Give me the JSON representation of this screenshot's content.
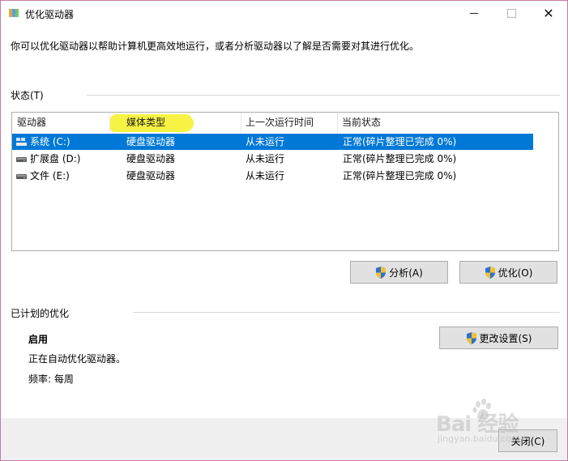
{
  "window": {
    "title": "优化驱动器",
    "close_glyph": "✕"
  },
  "description": "你可以优化驱动器以帮助计算机更高效地运行，或者分析驱动器以了解是否需要对其进行优化。",
  "status": {
    "label": "状态(T)",
    "columns": [
      "驱动器",
      "媒体类型",
      "上一次运行时间",
      "当前状态"
    ],
    "rows": [
      {
        "drive": "系统 (C:)",
        "media": "硬盘驱动器",
        "last_run": "从未运行",
        "state": "正常(碎片整理已完成 0%)",
        "icon": "system-drive-icon",
        "selected": true
      },
      {
        "drive": "扩展盘 (D:)",
        "media": "硬盘驱动器",
        "last_run": "从未运行",
        "state": "正常(碎片整理已完成 0%)",
        "icon": "hard-drive-icon",
        "selected": false
      },
      {
        "drive": "文件 (E:)",
        "media": "硬盘驱动器",
        "last_run": "从未运行",
        "state": "正常(碎片整理已完成 0%)",
        "icon": "hard-drive-icon",
        "selected": false
      }
    ],
    "analyze_button": "分析(A)",
    "optimize_button": "优化(O)"
  },
  "scheduled": {
    "label": "已计划的优化",
    "state": "启用",
    "info": "正在自动优化驱动器。",
    "frequency": "频率: 每周",
    "change_settings_button": "更改设置(S)"
  },
  "footer": {
    "close_button": "关闭(C)"
  },
  "watermark": {
    "text": "Bai 经验",
    "sub": "jingyan.baidu.com"
  },
  "colors": {
    "selection": "#0078d7",
    "highlight": "#f7f23a",
    "button_bg": "#e1e1e1",
    "footer_bg": "#f0f0f0"
  }
}
